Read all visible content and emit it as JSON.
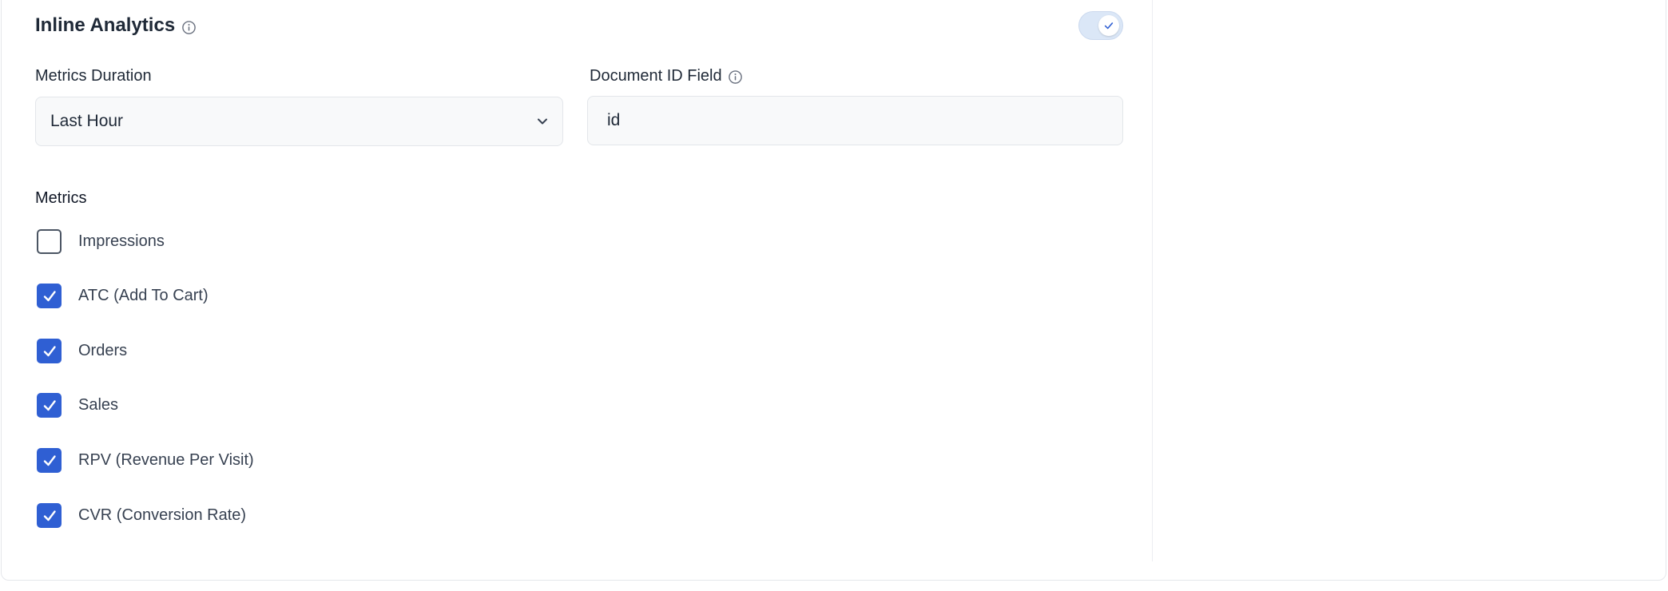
{
  "section": {
    "title": "Inline Analytics",
    "enabled": true
  },
  "metrics_duration": {
    "label": "Metrics Duration",
    "selected": "Last Hour"
  },
  "document_id": {
    "label": "Document ID Field",
    "value": "id"
  },
  "metrics": {
    "label": "Metrics",
    "items": [
      {
        "label": "Impressions",
        "checked": false
      },
      {
        "label": "ATC (Add To Cart)",
        "checked": true
      },
      {
        "label": "Orders",
        "checked": true
      },
      {
        "label": "Sales",
        "checked": true
      },
      {
        "label": "RPV (Revenue Per Visit)",
        "checked": true
      },
      {
        "label": "CVR (Conversion Rate)",
        "checked": true
      }
    ]
  },
  "colors": {
    "accent": "#2f5fd3",
    "toggle_track": "#dbe7f7",
    "field_bg": "#f8f9fa"
  },
  "icons": {
    "info": "info-circle-icon",
    "chevron": "chevron-down-icon",
    "check": "check-icon"
  }
}
